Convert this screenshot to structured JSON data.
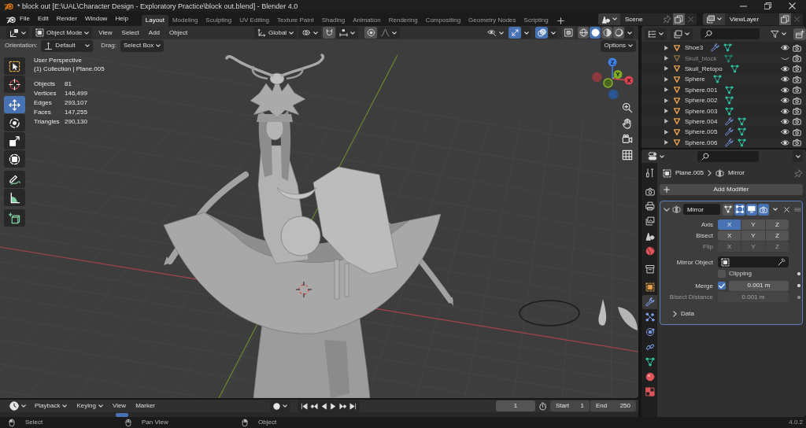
{
  "window": {
    "title": "* block out [E:\\UAL\\Character Design - Exploratory Practice\\block out.blend] - Blender 4.0"
  },
  "topbar": {
    "menus": [
      "File",
      "Edit",
      "Render",
      "Window",
      "Help"
    ],
    "workspaces": [
      {
        "label": "Layout",
        "selected": true
      },
      {
        "label": "Modeling",
        "selected": false
      },
      {
        "label": "Sculpting",
        "selected": false
      },
      {
        "label": "UV Editing",
        "selected": false
      },
      {
        "label": "Texture Paint",
        "selected": false
      },
      {
        "label": "Shading",
        "selected": false
      },
      {
        "label": "Animation",
        "selected": false
      },
      {
        "label": "Rendering",
        "selected": false
      },
      {
        "label": "Compositing",
        "selected": false
      },
      {
        "label": "Geometry Nodes",
        "selected": false
      },
      {
        "label": "Scripting",
        "selected": false
      }
    ],
    "scene": "Scene",
    "view_layer": "ViewLayer"
  },
  "viewport": {
    "header": {
      "mode": "Object Mode",
      "menus": [
        "View",
        "Select",
        "Add",
        "Object"
      ],
      "orientation": "Global",
      "gizmos": true,
      "overlays": true,
      "xray": false,
      "shading": [
        {
          "kind": "wireframe",
          "selected": false
        },
        {
          "kind": "solid",
          "selected": true
        },
        {
          "kind": "material",
          "selected": false
        },
        {
          "kind": "rendered",
          "selected": false
        }
      ]
    },
    "tool_settings": {
      "orientation_label": "Orientation:",
      "orientation": "Default",
      "drag_label": "Drag:",
      "drag": "Select Box",
      "options": "Options"
    },
    "tool_groups": [
      [
        {
          "kind": "select_box",
          "selected": false
        },
        {
          "kind": "cursor",
          "selected": false
        }
      ],
      [
        {
          "kind": "move",
          "selected": true
        },
        {
          "kind": "rotate",
          "selected": false
        },
        {
          "kind": "scale",
          "selected": false
        },
        {
          "kind": "transform",
          "selected": false
        }
      ],
      [
        {
          "kind": "annotate",
          "selected": false
        },
        {
          "kind": "measure",
          "selected": false
        }
      ],
      [
        {
          "kind": "add_cube",
          "selected": false
        }
      ]
    ],
    "view_name": "User Perspective",
    "context": "(1) Collection | Plane.005",
    "stats": [
      {
        "label": "Objects",
        "value": "81"
      },
      {
        "label": "Vertices",
        "value": "146,499"
      },
      {
        "label": "Edges",
        "value": "293,107"
      },
      {
        "label": "Faces",
        "value": "147,255"
      },
      {
        "label": "Triangles",
        "value": "290,130"
      }
    ],
    "gizmo_axes": [
      {
        "kind": "x",
        "label": "X"
      },
      {
        "kind": "y",
        "label": "Y"
      },
      {
        "kind": "z",
        "label": "Z"
      }
    ]
  },
  "outliner": {
    "rows": [
      {
        "name": "Shoe3",
        "modifiers": true,
        "hidden": false
      },
      {
        "name": "Skull_block",
        "modifiers": false,
        "hidden": true
      },
      {
        "name": "Skull_Retopo",
        "modifiers": false,
        "hidden": false
      },
      {
        "name": "Sphere",
        "modifiers": false,
        "hidden": false
      },
      {
        "name": "Sphere.001",
        "modifiers": false,
        "hidden": false
      },
      {
        "name": "Sphere.002",
        "modifiers": false,
        "hidden": false
      },
      {
        "name": "Sphere.003",
        "modifiers": false,
        "hidden": false
      },
      {
        "name": "Sphere.004",
        "modifiers": true,
        "hidden": false
      },
      {
        "name": "Sphere.005",
        "modifiers": true,
        "hidden": false
      },
      {
        "name": "Sphere.006",
        "modifiers": true,
        "hidden": false
      }
    ]
  },
  "properties": {
    "tab_groups": [
      [
        {
          "kind": "tool",
          "selected": false
        }
      ],
      [
        {
          "kind": "render",
          "selected": false
        },
        {
          "kind": "output",
          "selected": false
        },
        {
          "kind": "view_layer",
          "selected": false
        },
        {
          "kind": "scene",
          "selected": false
        },
        {
          "kind": "world",
          "selected": false
        }
      ],
      [
        {
          "kind": "collection",
          "selected": false
        }
      ],
      [
        {
          "kind": "object",
          "selected": false
        },
        {
          "kind": "modifiers",
          "selected": true
        },
        {
          "kind": "particles",
          "selected": false
        },
        {
          "kind": "physics",
          "selected": false
        },
        {
          "kind": "constraints",
          "selected": false
        },
        {
          "kind": "data",
          "selected": false
        },
        {
          "kind": "material",
          "selected": false
        },
        {
          "kind": "texture",
          "selected": false
        }
      ]
    ],
    "object": "Plane.005",
    "active_modifier": "Mirror",
    "add_modifier": "Add Modifier",
    "modifier": {
      "name": "Mirror",
      "expanded": true,
      "on_cage": false,
      "edit_mode": true,
      "viewport": true,
      "render": true,
      "axis_rows": [
        {
          "label": "Axis",
          "disabled": false,
          "axes": [
            {
              "label": "X",
              "selected": true
            },
            {
              "label": "Y",
              "selected": false
            },
            {
              "label": "Z",
              "selected": false
            }
          ]
        },
        {
          "label": "Bisect",
          "disabled": false,
          "axes": [
            {
              "label": "X",
              "selected": false
            },
            {
              "label": "Y",
              "selected": false
            },
            {
              "label": "Z",
              "selected": false
            }
          ]
        },
        {
          "label": "Flip",
          "disabled": true,
          "axes": [
            {
              "label": "X",
              "selected": false
            },
            {
              "label": "Y",
              "selected": false
            },
            {
              "label": "Z",
              "selected": false
            }
          ]
        }
      ],
      "mirror_object": {
        "label": "Mirror Object"
      },
      "clipping": {
        "label": "Clipping",
        "checked": false
      },
      "merge": {
        "label": "Merge",
        "checked": true,
        "value": "0.001 m"
      },
      "bisect_distance": {
        "label": "Bisect Distance",
        "value": "0.001 m",
        "disabled": true
      },
      "data_panel": {
        "label": "Data",
        "expanded": false
      }
    }
  },
  "timeline": {
    "menus": [
      {
        "label": "Playback",
        "dropdown": true
      },
      {
        "label": "Keying",
        "dropdown": true
      },
      {
        "label": "View",
        "dropdown": false
      },
      {
        "label": "Marker",
        "dropdown": false
      }
    ],
    "current_frame": "1",
    "start_label": "Start",
    "start": "1",
    "end_label": "End",
    "end": "250"
  },
  "status_bar": {
    "hints": [
      {
        "kind": "left",
        "label": "Select"
      },
      {
        "kind": "middle",
        "label": "Pan View"
      },
      {
        "kind": "right",
        "label": "Object"
      }
    ],
    "version": "4.0.2"
  }
}
